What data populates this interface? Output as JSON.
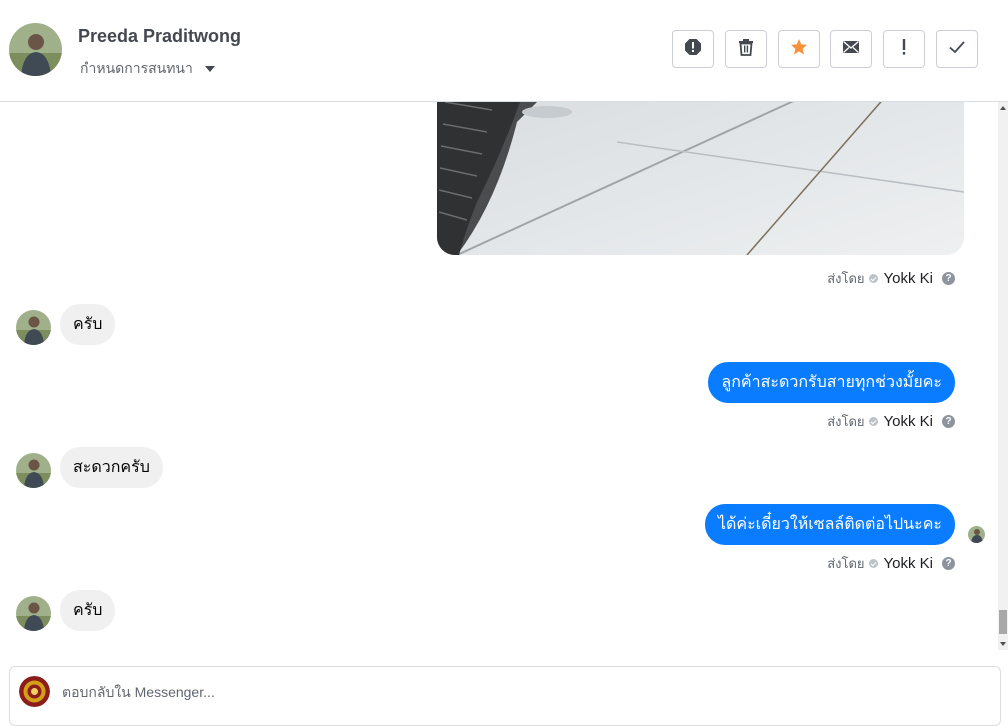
{
  "header": {
    "contact_name": "Preeda Praditwong",
    "assign_label": "กำหนดการสนทนา",
    "toolbar": [
      {
        "name": "spam-button",
        "icon": "stop-alert-icon"
      },
      {
        "name": "delete-button",
        "icon": "trash-icon"
      },
      {
        "name": "star-button",
        "icon": "star-icon"
      },
      {
        "name": "mark-unread-button",
        "icon": "envelope-icon"
      },
      {
        "name": "follow-up-button",
        "icon": "exclamation-icon"
      },
      {
        "name": "mark-done-button",
        "icon": "checkmark-icon"
      }
    ]
  },
  "conversation": {
    "sent_by_label": "ส่งโดย",
    "agent_name": "Yokk Ki",
    "help_glyph": "?",
    "messages": [
      {
        "from": "customer",
        "text": "ครับ"
      },
      {
        "from": "page",
        "text": "ลูกค้าสะดวกรับสายทุกช่วงมั้ยคะ"
      },
      {
        "from": "customer",
        "text": "สะดวกครับ"
      },
      {
        "from": "page",
        "text": "ได้ค่ะเดี๋ยวให้เซลล์ติดต่อไปนะคะ"
      },
      {
        "from": "customer",
        "text": "ครับ"
      }
    ]
  },
  "composer": {
    "placeholder": "ตอบกลับใน Messenger..."
  },
  "colors": {
    "outgoing_bubble": "#0a7cff",
    "incoming_bubble": "#f0f0f0",
    "star": "#f7923a"
  }
}
